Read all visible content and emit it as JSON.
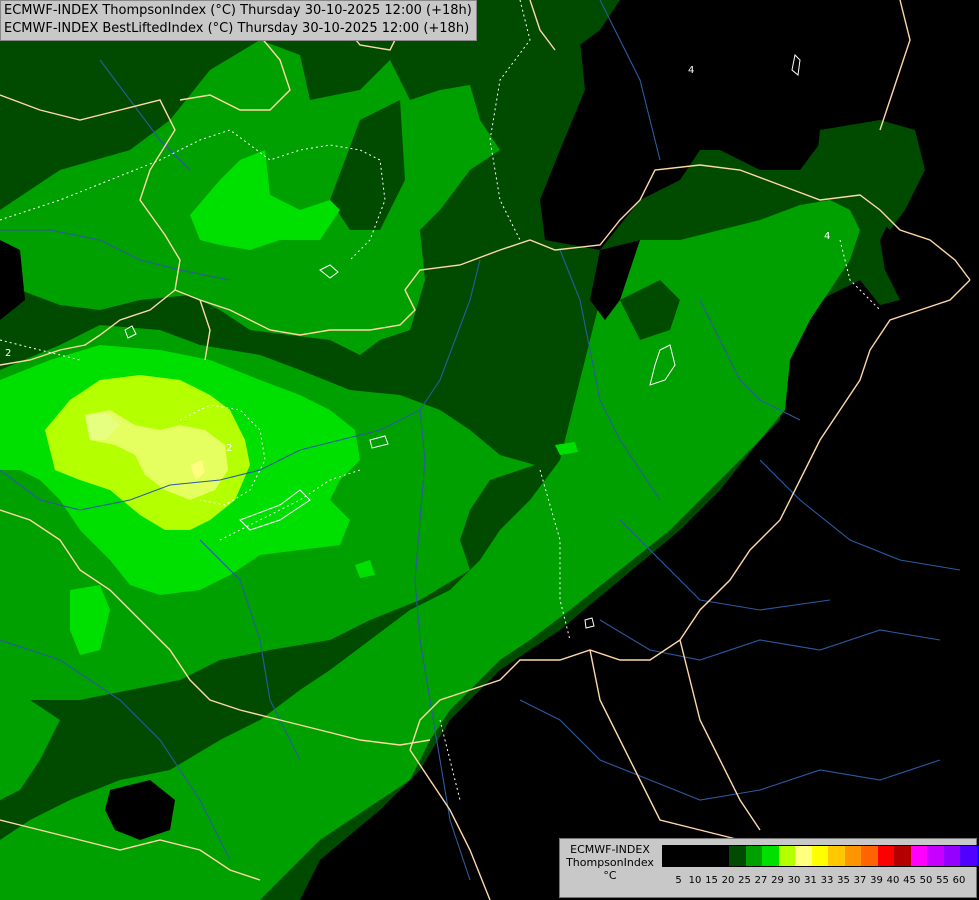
{
  "header": {
    "line1": "ECMWF-INDEX ThompsonIndex (°C) Thursday 30-10-2025 12:00 (+18h)",
    "line2": "ECMWF-INDEX BestLiftedIndex (°C) Thursday 30-10-2025 12:00 (+18h)"
  },
  "legend": {
    "title_line1": "ECMWF-INDEX",
    "title_line2": "ThompsonIndex",
    "unit": "°C",
    "colors": [
      "#000000",
      "#000000",
      "#000000",
      "#000000",
      "#004b00",
      "#00a000",
      "#00e000",
      "#b4ff00",
      "#ffff80",
      "#ffff00",
      "#ffc800",
      "#ff9600",
      "#ff6400",
      "#ff0000",
      "#b40000",
      "#ff00ff",
      "#c800ff",
      "#9600ff",
      "#5000ff",
      "#0000ff"
    ],
    "ticks": [
      "5",
      "10",
      "15",
      "20",
      "25",
      "27",
      "29",
      "30",
      "31",
      "33",
      "35",
      "37",
      "39",
      "40",
      "45",
      "50",
      "55",
      "60"
    ]
  },
  "contour_labels": [
    "4",
    "4",
    "2",
    "2"
  ],
  "palette": {
    "background": "#000000",
    "dark_green": "#004b00",
    "mid_green": "#00a000",
    "bright_green": "#00e000",
    "lime": "#b4ff00",
    "pale_yellow": "#ffff80",
    "border": "#ffd8a8",
    "river": "#2a5aa0",
    "contour": "#ffffff"
  }
}
